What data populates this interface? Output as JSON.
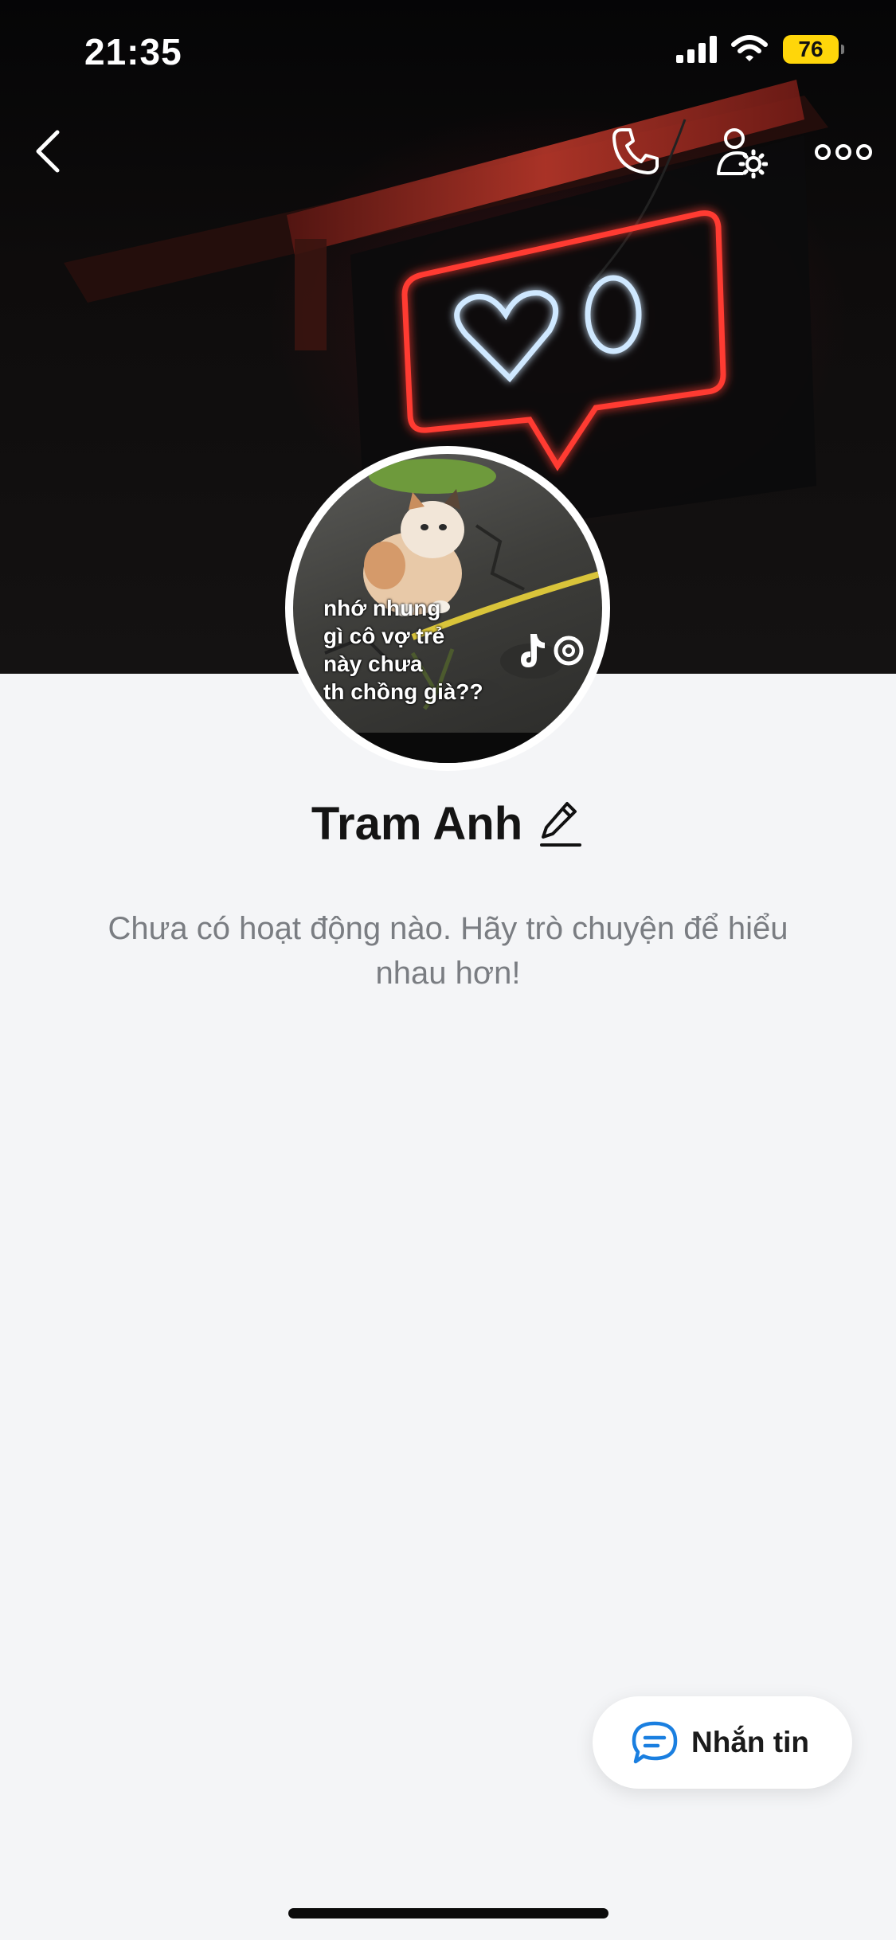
{
  "status_bar": {
    "time": "21:35",
    "battery": "76",
    "icons": [
      "cellular-signal-icon",
      "wifi-icon",
      "battery-icon"
    ]
  },
  "nav": {
    "icons": [
      "chevron-left-icon",
      "phone-icon",
      "user-settings-icon",
      "more-horizontal-icon"
    ]
  },
  "profile": {
    "name": "Tram Anh",
    "avatar_caption": [
      "nhớ nhung",
      "gì cô vợ trẻ",
      "này chưa",
      "th chồng già??"
    ],
    "empty_message": "Chưa có hoạt động nào. Hãy trò chuyện để hiểu nhau hơn!"
  },
  "actions": {
    "message_label": "Nhắn tin"
  },
  "colors": {
    "accent": "#1a7fe0",
    "battery": "#ffd60a",
    "background": "#f4f5f7",
    "neon_red": "#ff3b30",
    "neon_blue": "#cfe8ff"
  }
}
